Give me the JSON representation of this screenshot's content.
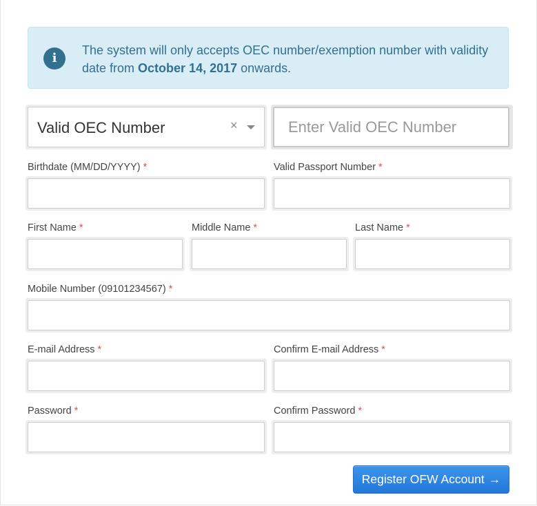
{
  "notice": {
    "icon": "info-icon",
    "text_before": "The system will only accepts OEC number/exemption number with validity date from ",
    "date": "October 14, 2017",
    "text_after": " onwards."
  },
  "oec_type_select": {
    "selected": "Valid OEC Number",
    "clear_symbol": "×"
  },
  "oec_number_input": {
    "placeholder": "Enter Valid OEC Number",
    "value": ""
  },
  "fields": {
    "birthdate": {
      "label": "Birthdate (MM/DD/YYYY)",
      "required": "*",
      "value": ""
    },
    "passport": {
      "label": "Valid Passport Number",
      "required": "*",
      "value": ""
    },
    "first_name": {
      "label": "First Name",
      "required": "*",
      "value": ""
    },
    "middle_name": {
      "label": "Middle Name",
      "required": "*",
      "value": ""
    },
    "last_name": {
      "label": "Last Name",
      "required": "*",
      "value": ""
    },
    "mobile": {
      "label": "Mobile Number (09101234567)",
      "required": "*",
      "value": ""
    },
    "email": {
      "label": "E-mail Address",
      "required": "*",
      "value": ""
    },
    "confirm_email": {
      "label": "Confirm E-mail Address",
      "required": "*",
      "value": ""
    },
    "password": {
      "label": "Password",
      "required": "*",
      "value": ""
    },
    "confirm_password": {
      "label": "Confirm Password",
      "required": "*",
      "value": ""
    }
  },
  "submit": {
    "label": "Register OFW Account",
    "arrow": "→"
  },
  "colors": {
    "alert_bg": "#d9edf7",
    "alert_text": "#31708f",
    "required_marker": "#d9534f",
    "button_blue": "#2a7fdf"
  }
}
